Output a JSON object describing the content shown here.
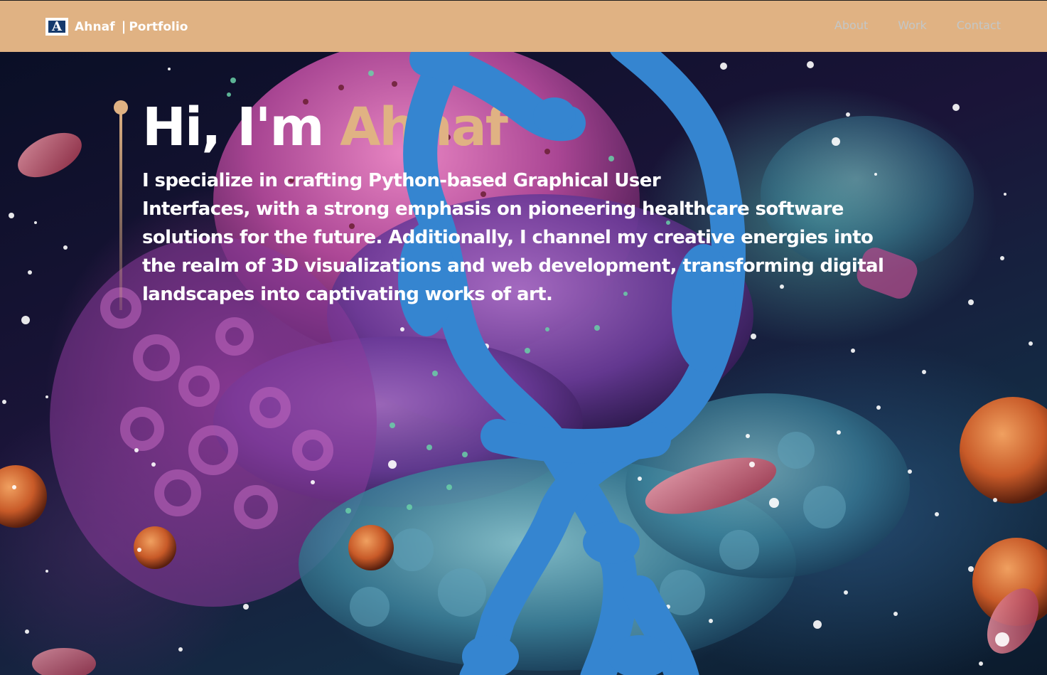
{
  "nav": {
    "logo_letter": "A",
    "brand_name": "Ahnaf",
    "separator": "|",
    "brand_sub": "Portfolio",
    "links": [
      {
        "label": "About"
      },
      {
        "label": "Work"
      },
      {
        "label": "Contact"
      }
    ]
  },
  "hero": {
    "greeting": "Hi, I'm",
    "name": "Ahnaf",
    "description_lines": [
      "I specialize in crafting Python-based Graphical User",
      "Interfaces, with a strong emphasis on pioneering healthcare software",
      "solutions for the future. Additionally, I channel my creative energies into",
      "the realm of 3D visualizations and web development, transforming digital",
      "landscapes into captivating works of art."
    ]
  },
  "colors": {
    "nav_bg": "#e0b283",
    "accent": "#e0b283",
    "brush": "#3585d0",
    "nav_link": "#c3c7c8"
  }
}
